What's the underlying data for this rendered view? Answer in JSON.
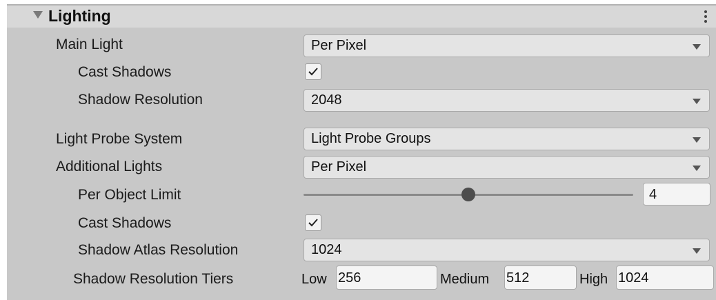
{
  "section": {
    "title": "Lighting"
  },
  "main_light": {
    "label": "Main Light",
    "mode": "Per Pixel",
    "cast_shadows_label": "Cast Shadows",
    "cast_shadows": true,
    "shadow_resolution_label": "Shadow Resolution",
    "shadow_resolution": "2048"
  },
  "light_probe": {
    "label": "Light Probe System",
    "value": "Light Probe Groups"
  },
  "additional_lights": {
    "label": "Additional Lights",
    "mode": "Per Pixel",
    "per_object_limit_label": "Per Object Limit",
    "per_object_limit": "4",
    "per_object_limit_fraction": 0.5,
    "cast_shadows_label": "Cast Shadows",
    "cast_shadows": true,
    "shadow_atlas_label": "Shadow Atlas Resolution",
    "shadow_atlas": "1024",
    "tiers_label": "Shadow Resolution Tiers",
    "tiers": {
      "low_label": "Low",
      "low": "256",
      "medium_label": "Medium",
      "medium": "512",
      "high_label": "High",
      "high": "1024"
    }
  },
  "icons": [
    "foldout-arrow-icon",
    "more-options-icon",
    "dropdown-caret-icon",
    "checkmark-icon"
  ]
}
